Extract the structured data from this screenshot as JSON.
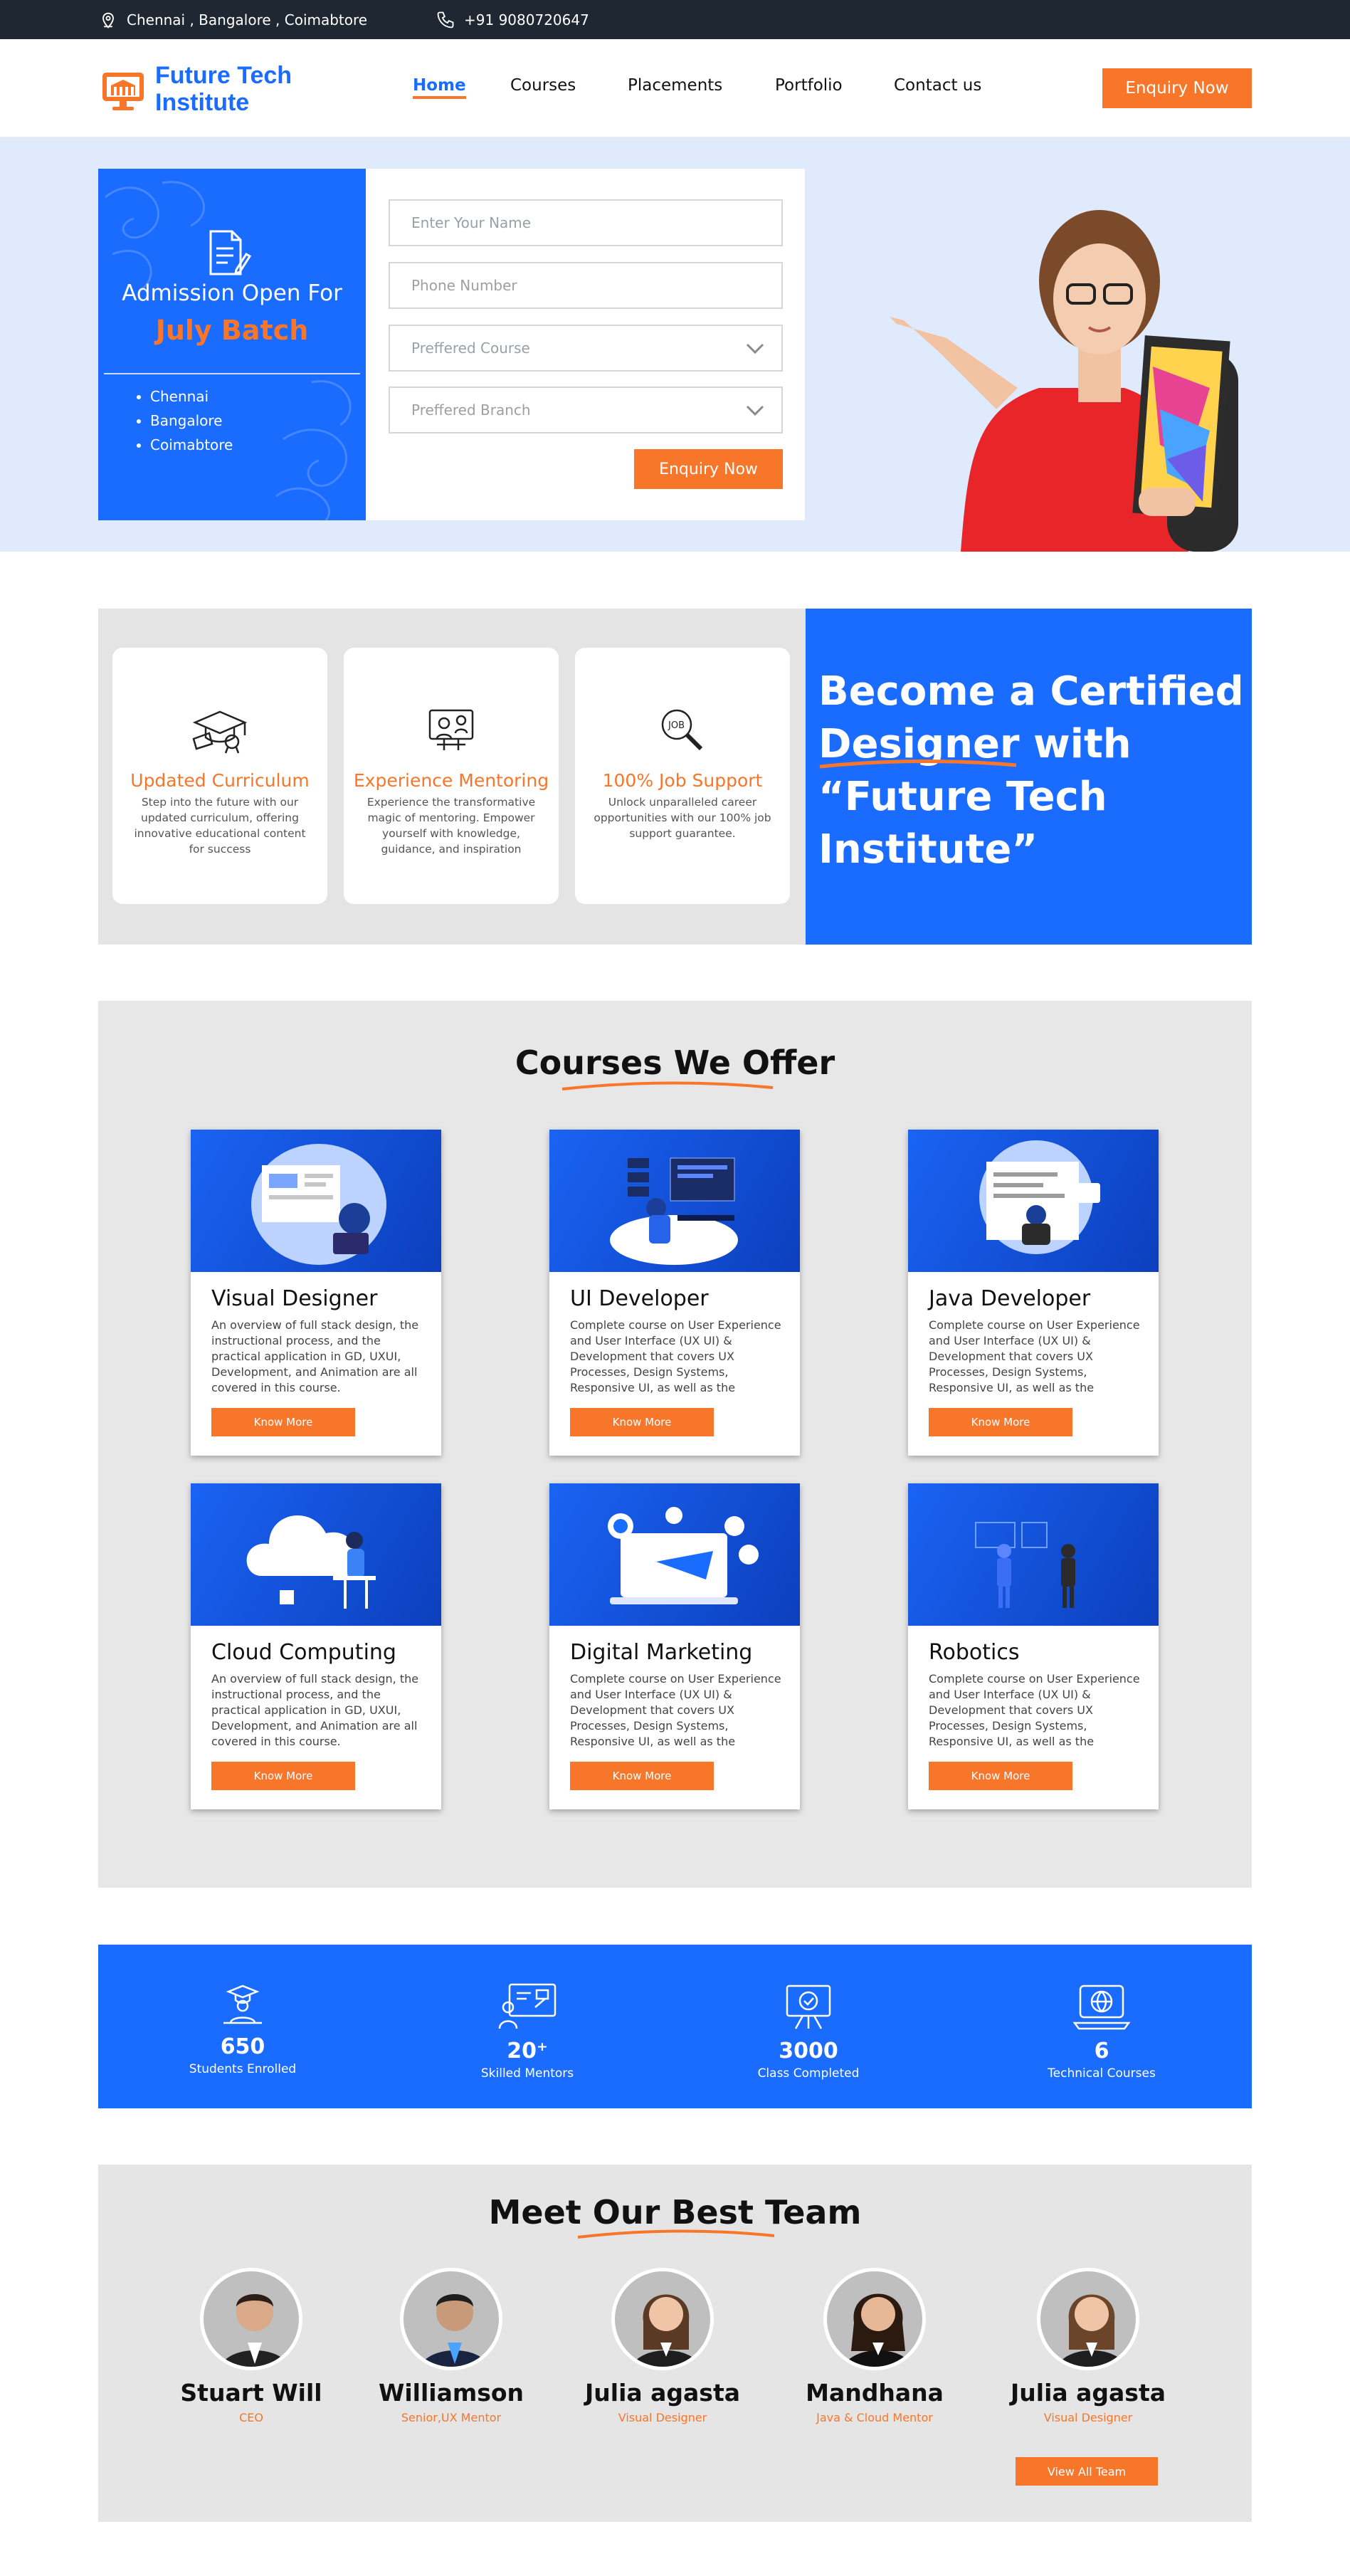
{
  "topbar": {
    "location_icon": "map-pin-icon",
    "locations": "Chennai , Bangalore , Coimabtore",
    "phone_icon": "phone-icon",
    "phone": "+91 9080720647"
  },
  "header": {
    "logo_icon": "monitor-school-icon",
    "logo_line1": "Future Tech",
    "logo_line2": "Institute",
    "nav": [
      "Home",
      "Courses",
      "Placements",
      "Portfolio",
      "Contact us"
    ],
    "active_nav": "Home",
    "enquiry_button": "Enquiry Now"
  },
  "hero": {
    "document_icon": "document-pen-icon",
    "admission_text": "Admission Open For",
    "batch_text": "July Batch",
    "cities": [
      "Chennai",
      "Bangalore",
      "Coimabtore"
    ],
    "form": {
      "name_placeholder": "Enter Your Name",
      "phone_placeholder": "Phone Number",
      "course_placeholder": "Preffered Course",
      "branch_placeholder": "Preffered Branch",
      "submit_label": "Enquiry Now"
    }
  },
  "features": [
    {
      "icon": "graduation-cap-icon",
      "title": "Updated Curriculum",
      "desc": "Step into the future with our updated curriculum, offering innovative educational content for success"
    },
    {
      "icon": "mentor-presentation-icon",
      "title": "Experience Mentoring",
      "desc": "Experience the transformative magic of mentoring. Empower yourself with knowledge, guidance, and inspiration"
    },
    {
      "icon": "job-search-icon",
      "title": "100% Job Support",
      "desc": "Unlock unparalleled career opportunities with our 100% job support guarantee."
    }
  ],
  "certified": {
    "line1": "Become a Certified",
    "line2_highlight": "Designer",
    "line2_rest": " with",
    "line3": "“Future Tech",
    "line4": "Institute”"
  },
  "courses": {
    "title": "Courses We Offer",
    "button_label": "Know More",
    "items": [
      {
        "title": "Visual Designer",
        "desc": "An overview of full stack design, the instructional process, and the practical application in GD, UXUI, Development, and Animation are all covered in this course."
      },
      {
        "title": "UI Developer",
        "desc": "Complete course on User Experience and User Interface (UX UI) & Development that covers UX Processes, Design Systems, Responsive UI, as well as the"
      },
      {
        "title": "Java Developer",
        "desc": "Complete course on User Experience and User Interface (UX UI) & Development that covers UX Processes, Design Systems, Responsive UI, as well as the"
      },
      {
        "title": "Cloud Computing",
        "desc": "An overview of full stack design, the instructional process, and the practical application in GD, UXUI, Development, and Animation are all covered in this course."
      },
      {
        "title": "Digital Marketing",
        "desc": "Complete course on User Experience and User Interface (UX UI) & Development that covers UX Processes, Design Systems, Responsive UI, as well as the"
      },
      {
        "title": "Robotics",
        "desc": "Complete course on User Experience and User Interface (UX UI) & Development that covers UX Processes, Design Systems, Responsive UI, as well as the"
      }
    ]
  },
  "stats": [
    {
      "icon": "graduate-student-icon",
      "value": "650",
      "label": "Students Enrolled"
    },
    {
      "icon": "mentor-board-icon",
      "value": "20⁺",
      "label": "Skilled Mentors"
    },
    {
      "icon": "classroom-board-icon",
      "value": "3000",
      "label": "Class Completed"
    },
    {
      "icon": "globe-laptop-icon",
      "value": "6",
      "label": "Technical Courses"
    }
  ],
  "team": {
    "title": "Meet Our Best Team",
    "members": [
      {
        "name": "Stuart Will",
        "role": "CEO"
      },
      {
        "name": "Williamson",
        "role": "Senior,UX Mentor"
      },
      {
        "name": "Julia agasta",
        "role": "Visual Designer"
      },
      {
        "name": "Mandhana",
        "role": "Java & Cloud Mentor"
      },
      {
        "name": "Julia agasta",
        "role": "Visual Designer"
      }
    ],
    "view_all_label": "View All Team"
  },
  "colors": {
    "accent_blue": "#1a6bff",
    "accent_orange": "#f7762a",
    "topbar": "#1f2732"
  }
}
